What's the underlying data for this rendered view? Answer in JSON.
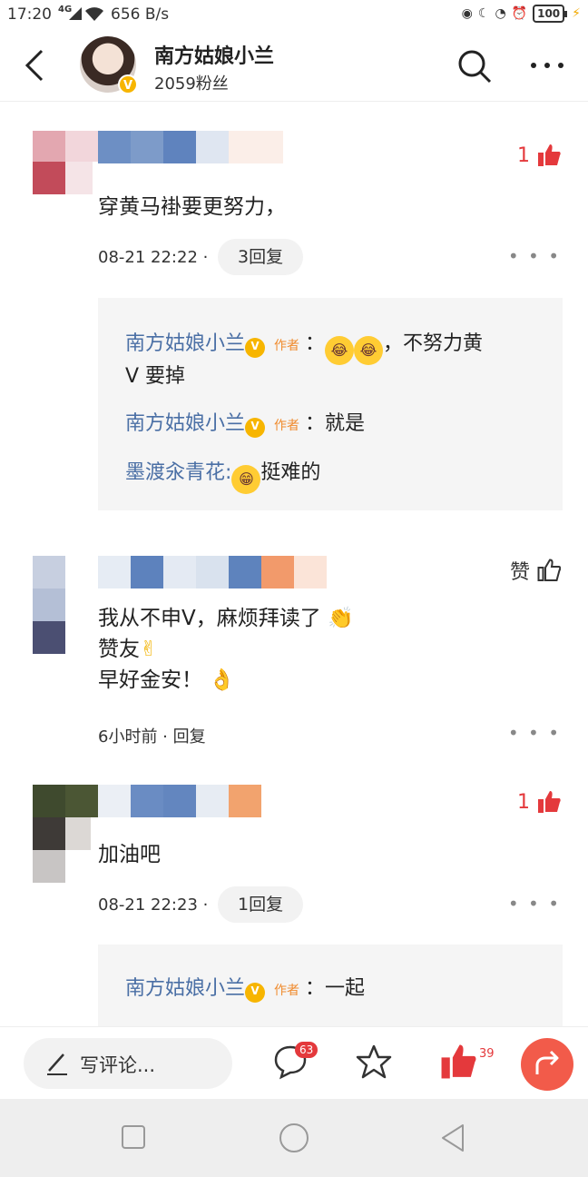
{
  "status_bar": {
    "time": "17:20",
    "network": "4G",
    "speed": "656 B/s",
    "battery": "100"
  },
  "header": {
    "name": "南方姑娘小兰",
    "fans": "2059粉丝",
    "verified_badge": "V"
  },
  "comments": [
    {
      "likes": "1",
      "text": "穿黄马褂要更努力，",
      "time": "08-21 22:22 ·",
      "reply_label": "3回复",
      "replies": [
        {
          "user": "南方姑娘小兰",
          "author_tag": "作者",
          "text_a": "：",
          "text_b": "，不努力黄",
          "text_c": "V 要掉"
        },
        {
          "user": "南方姑娘小兰",
          "author_tag": "作者",
          "text": "：就是"
        },
        {
          "user": "墨渡汆青花:",
          "text": "挺难的"
        }
      ]
    },
    {
      "likes": "赞",
      "lines": [
        "我从不申V，麻烦拜读了",
        "赞友",
        "早好金安！"
      ],
      "time": "6小时前 · 回复"
    },
    {
      "likes": "1",
      "text": "加油吧",
      "time": "08-21 22:23 ·",
      "reply_label": "1回复",
      "replies": [
        {
          "user": "南方姑娘小兰",
          "author_tag": "作者",
          "text": "：一起"
        }
      ]
    }
  ],
  "bottom_bar": {
    "comment_placeholder": "写评论...",
    "comment_count": "63",
    "like_count": "39"
  },
  "colors": {
    "accent_red": "#e4393c",
    "link_blue": "#4a6fa5",
    "author_orange": "#f08b2e",
    "verified_gold": "#f7b500"
  },
  "icons": [
    "back-icon",
    "search-icon",
    "more-icon",
    "thumb-up-icon",
    "comment-icon",
    "star-icon",
    "share-icon",
    "pen-icon"
  ]
}
